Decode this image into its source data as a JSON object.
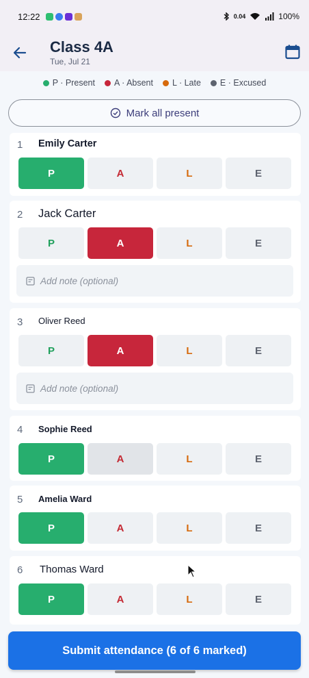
{
  "status": {
    "time": "12:22",
    "net_speed": "0.04",
    "battery": "100%"
  },
  "header": {
    "title": "Class 4A",
    "date": "Tue, Jul 21"
  },
  "legend": [
    {
      "label": "P · Present",
      "color": "#27ae6e"
    },
    {
      "label": "A · Absent",
      "color": "#c7263b"
    },
    {
      "label": "L · Late",
      "color": "#d66a0c"
    },
    {
      "label": "E · Excused",
      "color": "#5d636f"
    }
  ],
  "mark_all_label": "Mark all present",
  "options": {
    "p": "P",
    "a": "A",
    "l": "L",
    "e": "E"
  },
  "note_placeholder": "Add note (optional)",
  "students": [
    {
      "num": "1",
      "name": "Emily Carter",
      "status": "P"
    },
    {
      "num": "2",
      "name": "Jack Carter",
      "status": "A"
    },
    {
      "num": "3",
      "name": "Oliver Reed",
      "status": "A"
    },
    {
      "num": "4",
      "name": "Sophie Reed",
      "status": "P"
    },
    {
      "num": "5",
      "name": "Amelia Ward",
      "status": "P"
    },
    {
      "num": "6",
      "name": "Thomas Ward",
      "status": "P"
    }
  ],
  "submit_label": "Submit attendance (6 of 6 marked)",
  "colors": {
    "accent": "#1b71e6",
    "present": "#27ae6e",
    "absent": "#c7263b",
    "late": "#d66a0c",
    "excused": "#5d636f"
  }
}
